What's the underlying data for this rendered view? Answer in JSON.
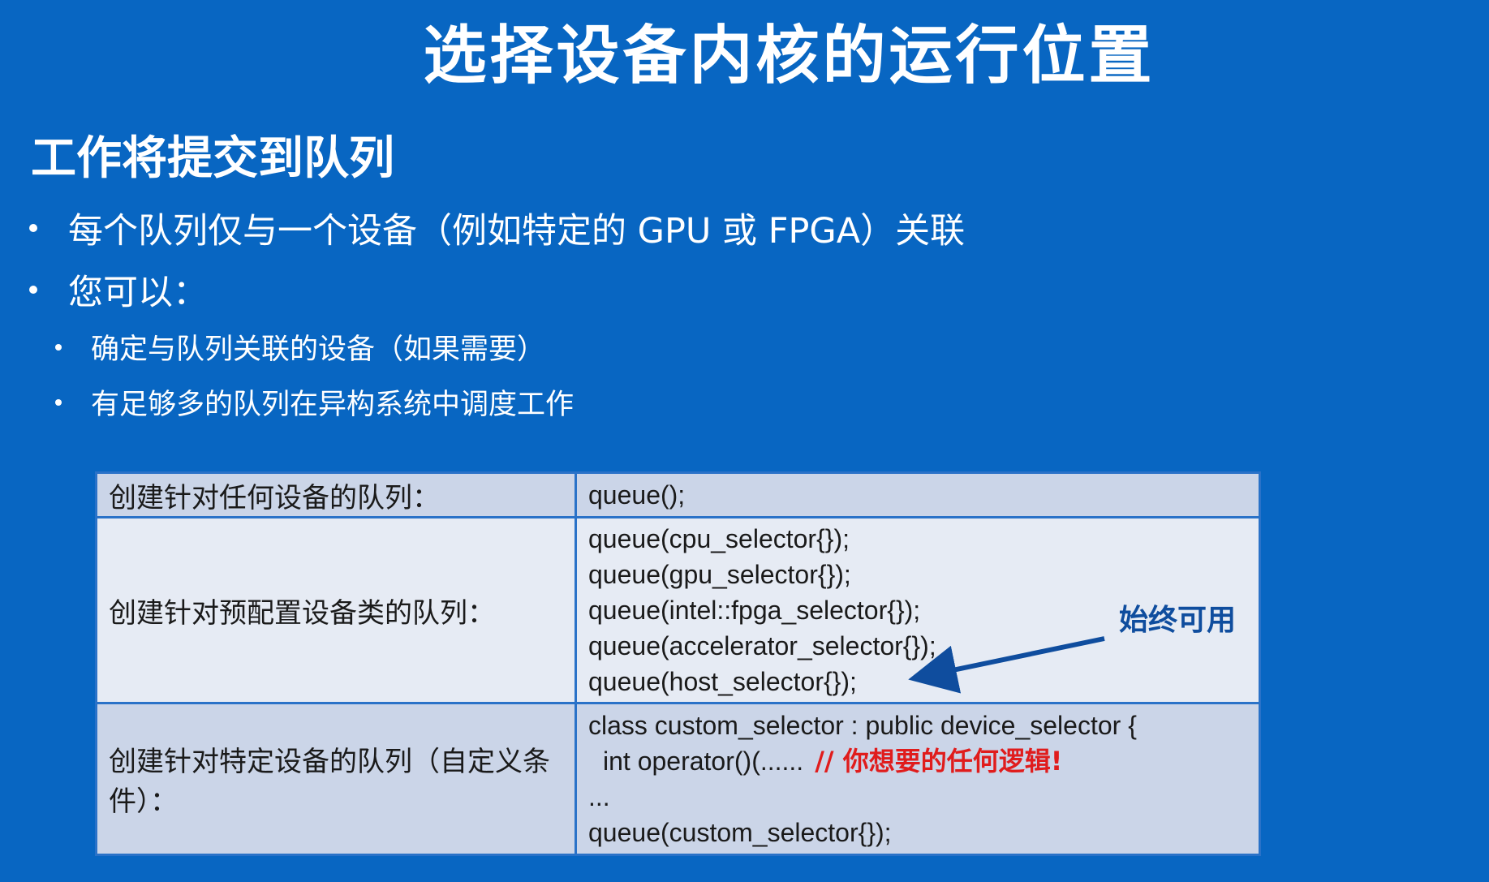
{
  "slide": {
    "title": "选择设备内核的运行位置",
    "subtitle": "工作将提交到队列",
    "bullets": [
      "每个队列仅与一个设备（例如特定的 GPU 或 FPGA）关联",
      "您可以："
    ],
    "sub_bullets": [
      "确定与队列关联的设备（如果需要）",
      "有足够多的队列在异构系统中调度工作"
    ]
  },
  "table": {
    "rows": [
      {
        "label": "创建针对任何设备的队列：",
        "code": [
          "queue();"
        ]
      },
      {
        "label": "创建针对预配置设备类的队列：",
        "code": [
          "queue(cpu_selector{});",
          "queue(gpu_selector{});",
          "queue(intel::fpga_selector{});",
          "queue(accelerator_selector{});",
          "queue(host_selector{});"
        ],
        "annotation": "始终可用"
      },
      {
        "label": "创建针对特定设备的队列（自定义条件）：",
        "code": [
          "class custom_selector : public device_selector {",
          "int operator()(......",
          "...",
          "queue(custom_selector{});"
        ],
        "comment": "// 你想要的任何逻辑!"
      }
    ]
  },
  "colors": {
    "background": "#0866c2",
    "annotation": "#0f4d9e",
    "comment": "#e01c1c"
  }
}
